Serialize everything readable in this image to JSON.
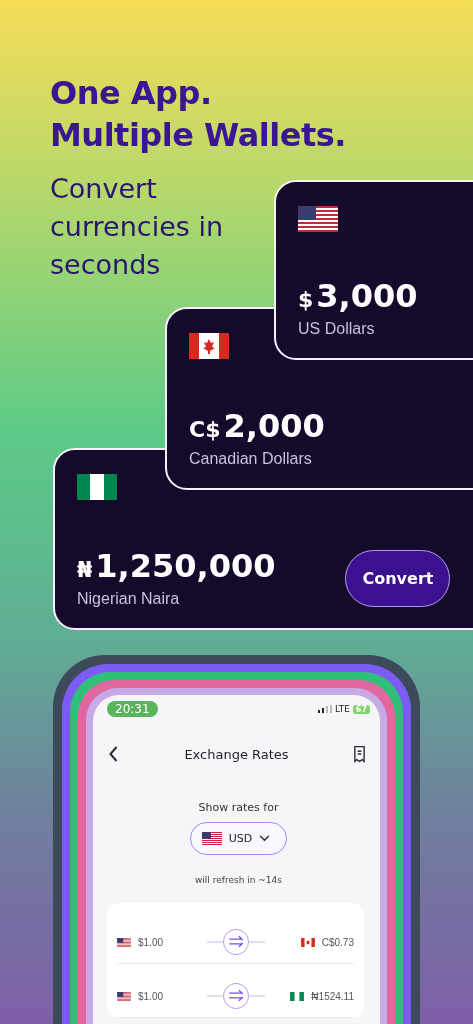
{
  "headline": [
    "One App.",
    "Multiple Wallets."
  ],
  "subtitle": "Convert currencies in seconds",
  "cards": [
    {
      "flag": {
        "kind": "us"
      },
      "symbol": "$",
      "amount": "3,000",
      "name": "US Dollars"
    },
    {
      "flag": {
        "kind": "ca"
      },
      "symbol": "C$",
      "amount": "2,000",
      "name": "Canadian Dollars"
    },
    {
      "flag": {
        "kind": "ng"
      },
      "symbol": "₦",
      "amount": "1,250,000",
      "name": "Nigerian Naira",
      "button": "Convert"
    }
  ],
  "phone": {
    "status": {
      "time": "20:31",
      "network": "LTE",
      "battery": "67"
    },
    "title": "Exchange Rates",
    "prompt": "Show rates for",
    "selector": {
      "flag": {
        "kind": "us"
      },
      "label": "USD"
    },
    "refresh": "will refresh in ~14s",
    "rates": [
      {
        "from_flag": {
          "kind": "us"
        },
        "from": "$1.00",
        "to_flag": {
          "kind": "ca"
        },
        "to": "C$0.73"
      },
      {
        "from_flag": {
          "kind": "us"
        },
        "from": "$1.00",
        "to_flag": {
          "kind": "ng"
        },
        "to": "₦1524.11"
      }
    ]
  }
}
